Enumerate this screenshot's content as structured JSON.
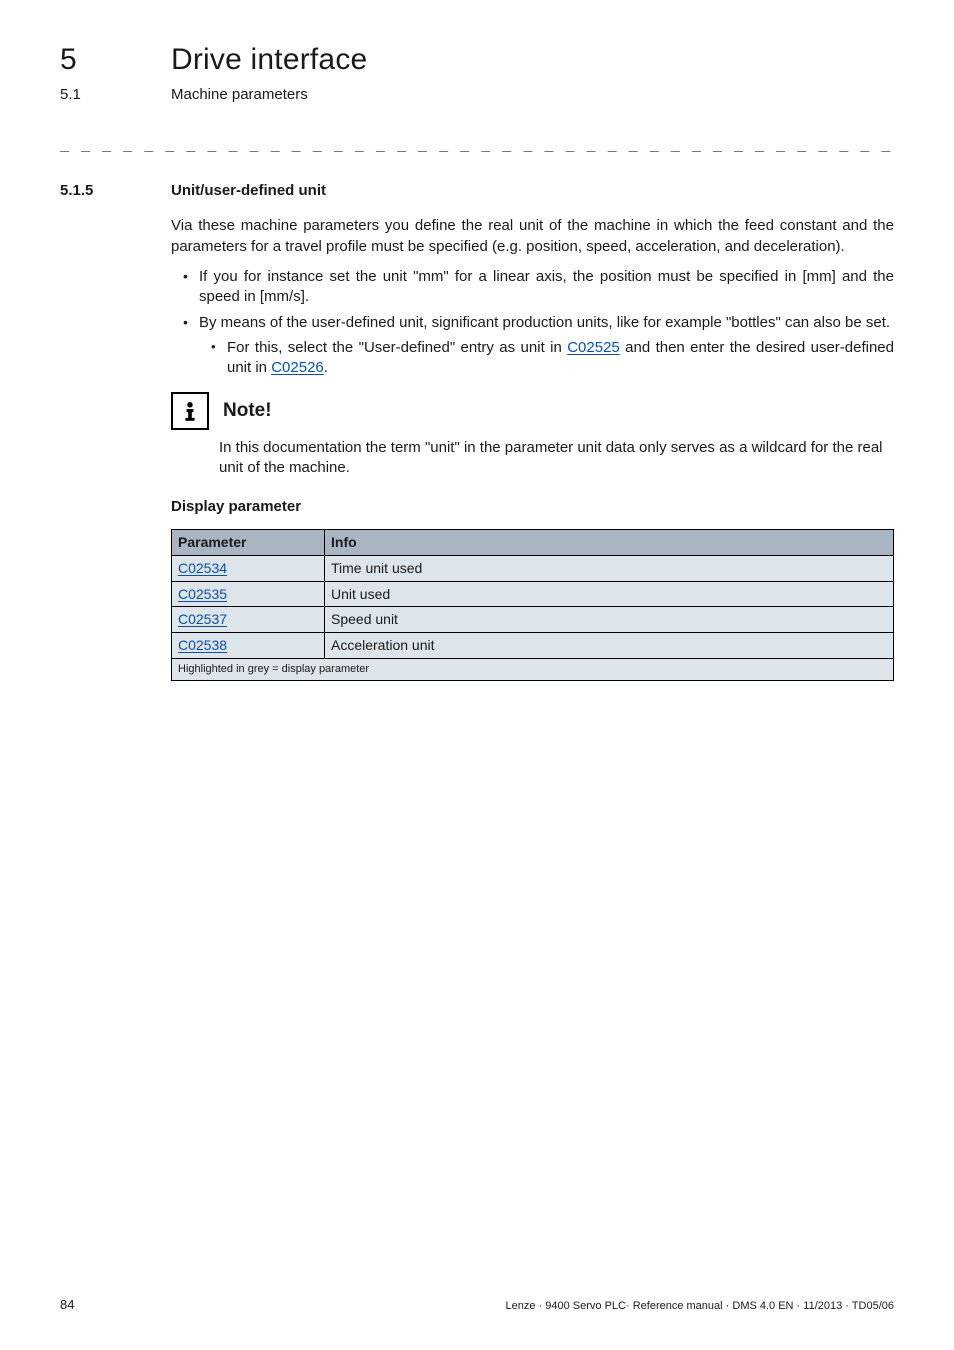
{
  "header": {
    "chapter_number": "5",
    "chapter_title": "Drive interface",
    "subsection_number": "5.1",
    "subsection_title": "Machine parameters"
  },
  "separator": "_ _ _ _ _ _ _ _ _ _ _ _ _ _ _ _ _ _ _ _ _ _ _ _ _ _ _ _ _ _ _ _ _ _ _ _ _ _ _ _ _ _ _ _ _ _ _ _ _ _ _ _ _ _ _ _ _ _ _ _ _ _ _ _",
  "section": {
    "number": "5.1.5",
    "title": "Unit/user-defined unit",
    "intro": "Via these machine parameters you define the real unit of the machine in which the feed constant and the parameters for a travel profile must be specified (e.g. position, speed, acceleration, and deceleration).",
    "bullets": [
      {
        "text": "If you for instance set the unit \"mm\" for a linear axis, the position must be specified in [mm] and the speed in [mm/s]."
      },
      {
        "text": "By means of the user-defined unit, significant production units, like for example \"bottles\" can also be set.",
        "sub": {
          "prefix": "For this, select the \"User-defined\" entry as unit in ",
          "link1": "C02525",
          "middle": " and then enter the desired user-defined unit in ",
          "link2": "C02526",
          "suffix": "."
        }
      }
    ]
  },
  "note": {
    "label": "Note!",
    "text": "In this documentation the term \"unit\" in the parameter unit data only serves as a wildcard for the real unit of the machine."
  },
  "display_param_heading": "Display parameter",
  "table": {
    "headers": {
      "col1": "Parameter",
      "col2": "Info"
    },
    "rows": [
      {
        "param": "C02534",
        "info": "Time unit used"
      },
      {
        "param": "C02535",
        "info": "Unit used"
      },
      {
        "param": "C02537",
        "info": "Speed unit"
      },
      {
        "param": "C02538",
        "info": "Acceleration unit"
      }
    ],
    "footnote": "Highlighted in grey = display parameter"
  },
  "footer": {
    "page": "84",
    "meta": "Lenze · 9400 Servo PLC· Reference manual · DMS 4.0 EN · 11/2013 · TD05/06"
  }
}
